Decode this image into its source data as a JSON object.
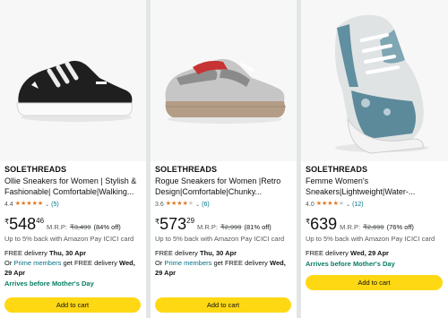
{
  "products": [
    {
      "brand": "SOLETHREADS",
      "title": "Ollie Sneakers for Women | Stylish & Fashionable| Comfortable|Walking...",
      "rating": "4.4",
      "stars": 4.4,
      "review_count": "(5)",
      "currency": "₹",
      "price_whole": "548",
      "price_fraction": "46",
      "mrp_label": "M.R.P:",
      "mrp_value": "₹3,499",
      "discount": "(84% off)",
      "cashback": "Up to 5% back with Amazon Pay ICICI card",
      "free_delivery_prefix": "FREE delivery",
      "free_delivery_date": "Thu, 30 Apr",
      "or_text": "Or",
      "prime_link": "Prime members",
      "prime_suffix": "get FREE delivery",
      "prime_date": "Wed, 29 Apr",
      "arrives": "Arrives before Mother's Day",
      "cart_label": "Add to cart"
    },
    {
      "brand": "SOLETHREADS",
      "title": "Rogue Sneakers for Women |Retro Design|Comfortable|Chunky...",
      "rating": "3.6",
      "stars": 3.6,
      "review_count": "(6)",
      "currency": "₹",
      "price_whole": "573",
      "price_fraction": "29",
      "mrp_label": "M.R.P:",
      "mrp_value": "₹2,999",
      "discount": "(81% off)",
      "cashback": "Up to 5% back with Amazon Pay ICICI card",
      "free_delivery_prefix": "FREE delivery",
      "free_delivery_date": "Thu, 30 Apr",
      "or_text": "Or",
      "prime_link": "Prime members",
      "prime_suffix": "get FREE delivery",
      "prime_date": "Wed, 29 Apr",
      "cart_label": "Add to cart"
    },
    {
      "brand": "SOLETHREADS",
      "title": "Femme Women's Sneakers|Lightweight|Water-...",
      "rating": "4.0",
      "stars": 4.0,
      "review_count": "(12)",
      "currency": "₹",
      "price_whole": "639",
      "mrp_label": "M.R.P:",
      "mrp_value": "₹2,699",
      "discount": "(76% off)",
      "cashback": "Up to 5% back with Amazon Pay ICICI card",
      "free_delivery_prefix": "FREE delivery",
      "free_delivery_date": "Wed, 29 Apr",
      "arrives": "Arrives before Mother's Day",
      "cart_label": "Add to cart"
    }
  ],
  "colors": {
    "star": "#de7921",
    "link": "#007185",
    "arrives": "#067d62",
    "cart_button": "#ffd814"
  }
}
